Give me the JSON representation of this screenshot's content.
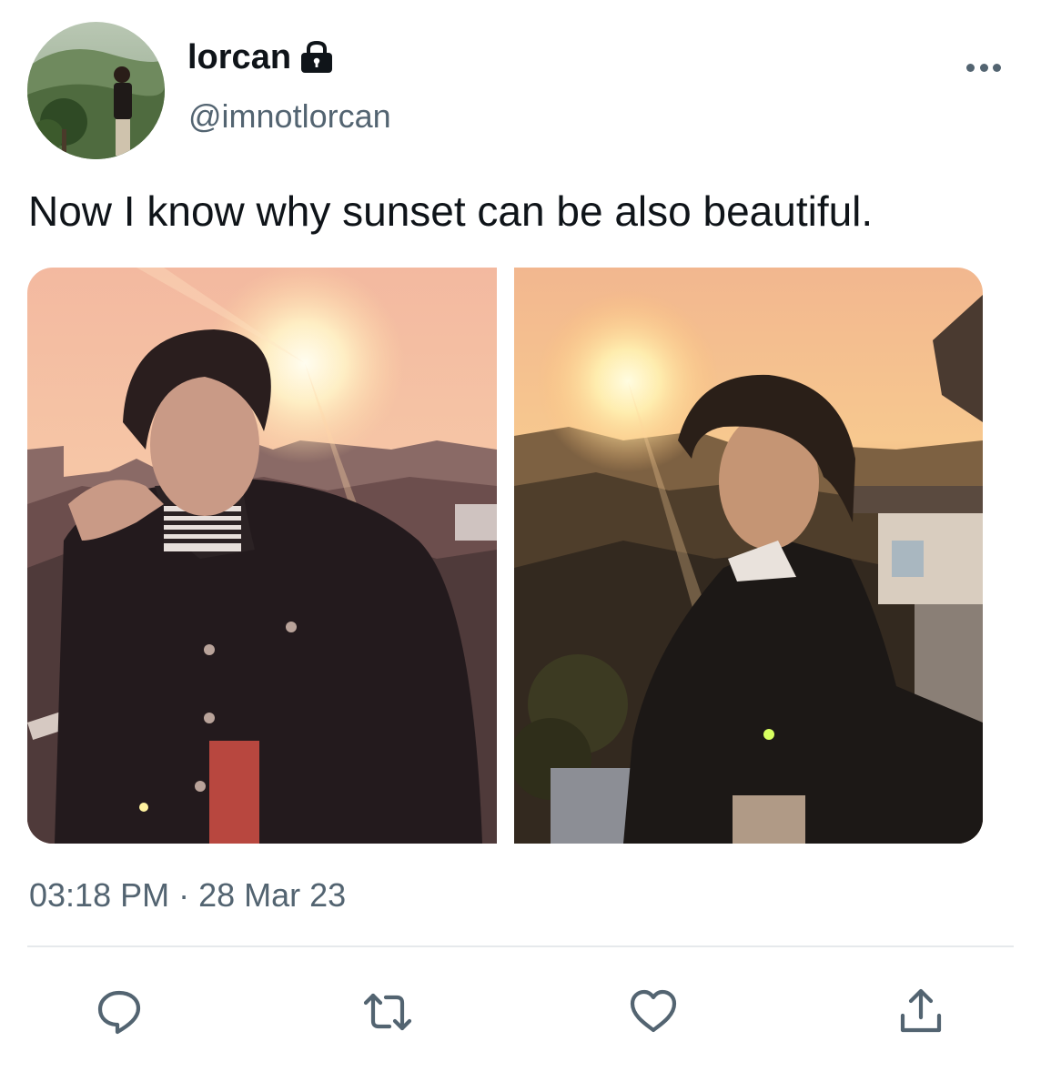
{
  "author": {
    "display_name": "lorcan",
    "handle": "@imnotlorcan",
    "protected_icon": "lock-icon"
  },
  "menu": {
    "icon": "more-horizontal-icon"
  },
  "tweet": {
    "text": "Now I know why sunset can be also beautiful.",
    "timestamp": "03:18 PM · 28 Mar 23"
  },
  "media": [
    {
      "kind": "photo",
      "description_icon": "photo-sunset-portrait"
    },
    {
      "kind": "photo",
      "description_icon": "photo-sunset-profile"
    }
  ],
  "actions": [
    {
      "icon": "reply-icon"
    },
    {
      "icon": "retweet-icon"
    },
    {
      "icon": "like-icon"
    },
    {
      "icon": "share-icon"
    }
  ],
  "colors": {
    "text": "#0f1419",
    "secondary": "#536471",
    "divider": "#e6e9ec"
  }
}
